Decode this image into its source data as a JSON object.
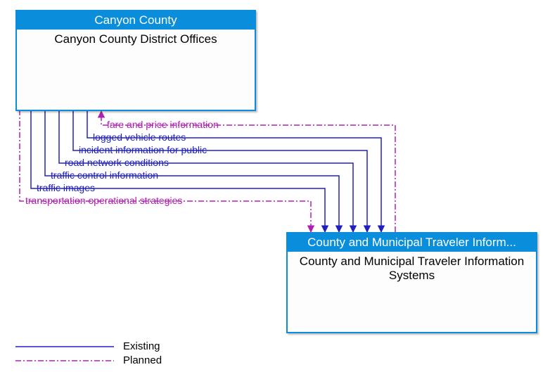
{
  "box_a": {
    "header": "Canyon County",
    "body": "Canyon County District Offices"
  },
  "box_b": {
    "header": "County and Municipal Traveler Inform...",
    "body": "County and Municipal Traveler Information Systems"
  },
  "flows": {
    "f1": "fare and price information",
    "f2": "logged vehicle routes",
    "f3": "incident information for public",
    "f4": "road network conditions",
    "f5": "traffic control information",
    "f6": "traffic images",
    "f7": "transportation operational strategies"
  },
  "legend": {
    "existing": "Existing",
    "planned": "Planned"
  },
  "colors": {
    "existing": "#2020c0",
    "planned": "#b020b0"
  },
  "chart_data": {
    "type": "diagram",
    "nodes": [
      {
        "id": "A",
        "group": "Canyon County",
        "label": "Canyon County District Offices"
      },
      {
        "id": "B",
        "group": "County and Municipal Traveler Information",
        "label": "County and Municipal Traveler Information Systems"
      }
    ],
    "edges": [
      {
        "from": "B",
        "to": "A",
        "label": "fare and price information",
        "status": "planned"
      },
      {
        "from": "A",
        "to": "B",
        "label": "logged vehicle routes",
        "status": "existing"
      },
      {
        "from": "A",
        "to": "B",
        "label": "incident information for public",
        "status": "existing"
      },
      {
        "from": "A",
        "to": "B",
        "label": "road network conditions",
        "status": "existing"
      },
      {
        "from": "A",
        "to": "B",
        "label": "traffic control information",
        "status": "existing"
      },
      {
        "from": "A",
        "to": "B",
        "label": "traffic images",
        "status": "existing"
      },
      {
        "from": "A",
        "to": "B",
        "label": "transportation operational strategies",
        "status": "planned"
      }
    ],
    "legend": [
      {
        "label": "Existing",
        "style": "solid",
        "color": "#2020c0"
      },
      {
        "label": "Planned",
        "style": "dash-dot",
        "color": "#b020b0"
      }
    ]
  }
}
